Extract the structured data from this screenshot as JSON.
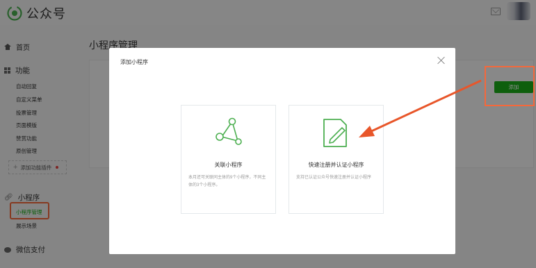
{
  "header": {
    "app_name": "公众号",
    "logo_icon": "wechat-official-account-icon",
    "mail_icon": "mail-icon"
  },
  "sidebar": {
    "home": "首页",
    "function_section": {
      "title": "功能",
      "items": [
        "自动回复",
        "自定义菜单",
        "投票管理",
        "页面模版",
        "赞赏功能",
        "原创管理"
      ],
      "add_plugin": "添加功能插件"
    },
    "miniprogram_section": {
      "title": "小程序",
      "items": [
        "小程序管理",
        "展示场景"
      ]
    },
    "payment": "微信支付"
  },
  "main": {
    "page_title": "小程序管理",
    "add_button": "添加"
  },
  "dialog": {
    "title": "添加小程序",
    "options": [
      {
        "title": "关联小程序",
        "desc": "本月还可关联同主体的9个小程序，不同主体的3个小程序。",
        "icon": "share-nodes-icon"
      },
      {
        "title": "快速注册并认证小程序",
        "desc": "支持已认证公众号快速注册并认证小程序",
        "icon": "document-edit-icon"
      }
    ]
  },
  "colors": {
    "brand_green": "#1aad19",
    "annotation_orange": "#f5683b",
    "annotation_arrow": "#e8562a"
  }
}
